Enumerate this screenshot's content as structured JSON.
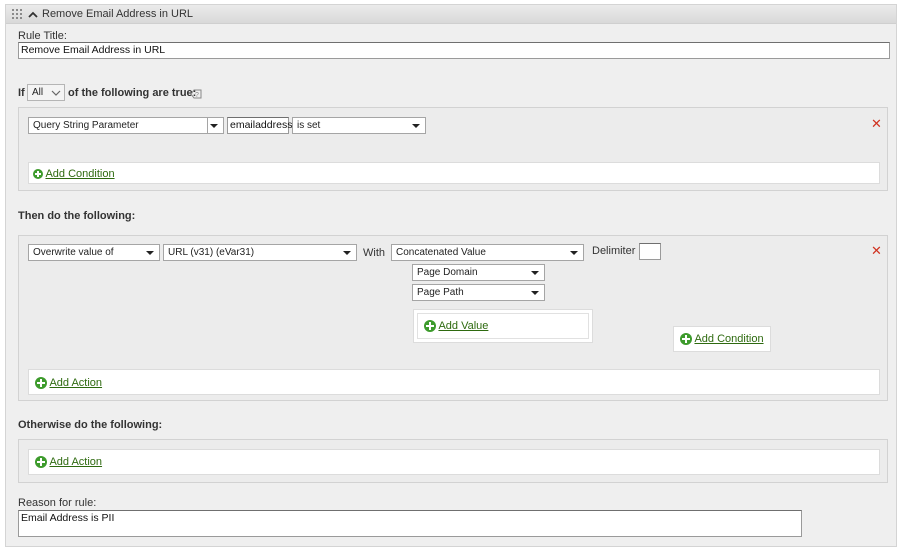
{
  "window": {
    "title": "Remove Email Address in URL"
  },
  "rule_title": {
    "label": "Rule Title:",
    "value": "Remove Email Address in URL"
  },
  "condition_header": {
    "if_label": "If",
    "match_value": "All",
    "following_label": "of the following are true:"
  },
  "condition": {
    "field": "Query String Parameter",
    "parameter": "emailaddress",
    "operator": "is set"
  },
  "add_condition_label": "Add Condition",
  "then_label": "Then do the following:",
  "action": {
    "operation": "Overwrite value of",
    "target": "URL (v31) (eVar31)",
    "with_label": "With",
    "with_value": "Concatenated Value",
    "delimiter_label": "Delimiter",
    "delimiter_value": "",
    "values": [
      "Page Domain",
      "Page Path"
    ],
    "add_value_label": "Add Value",
    "add_condition_label": "Add Condition"
  },
  "add_action_label": "Add Action",
  "otherwise_label": "Otherwise do the following:",
  "otherwise_add_action_label": "Add Action",
  "reason": {
    "label": "Reason for rule:",
    "value": "Email Address is PII"
  },
  "icons": {
    "grip": "drag-handle-icon",
    "collapse": "chevron-up-icon",
    "help": "help-icon",
    "remove": "close-icon",
    "add": "plus-circle-icon"
  },
  "colors": {
    "accent_green": "#3d9b2c",
    "link_green": "#2e6a0f",
    "remove_red": "#d0311f"
  }
}
